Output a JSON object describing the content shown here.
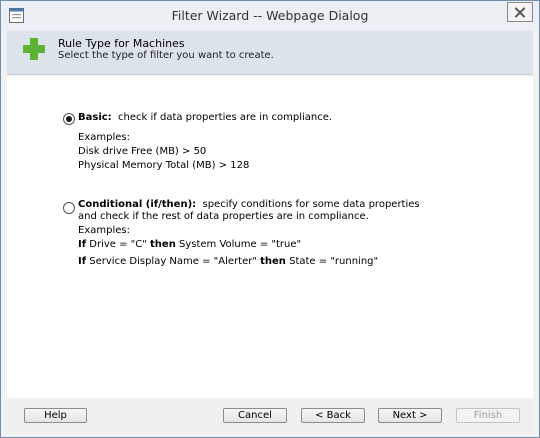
{
  "window": {
    "title": "Filter Wizard -- Webpage Dialog"
  },
  "header": {
    "title": "Rule Type for Machines",
    "subtitle": "Select the type of filter you want to create."
  },
  "options": {
    "basic": {
      "label": "Basic:",
      "desc": "check if data properties are in compliance.",
      "selected": true,
      "examples_label": "Examples:",
      "examples": [
        "Disk drive Free (MB) > 50",
        "Physical Memory Total (MB) > 128"
      ]
    },
    "conditional": {
      "label": "Conditional (if/then):",
      "desc": "specify conditions for some data properties",
      "desc2": "and check if the rest of data properties are in compliance.",
      "selected": false,
      "examples_label": "Examples:",
      "ex1": {
        "kw1": "If",
        "t1": " Drive = \"C\" ",
        "kw2": "then",
        "t2": " System Volume = \"true\""
      },
      "ex2": {
        "kw1": "If",
        "t1": " Service Display Name = \"Alerter\" ",
        "kw2": "then",
        "t2": " State = \"running\""
      }
    }
  },
  "buttons": {
    "help": "Help",
    "cancel": "Cancel",
    "back": "< Back",
    "next": "Next >",
    "finish": "Finish"
  }
}
